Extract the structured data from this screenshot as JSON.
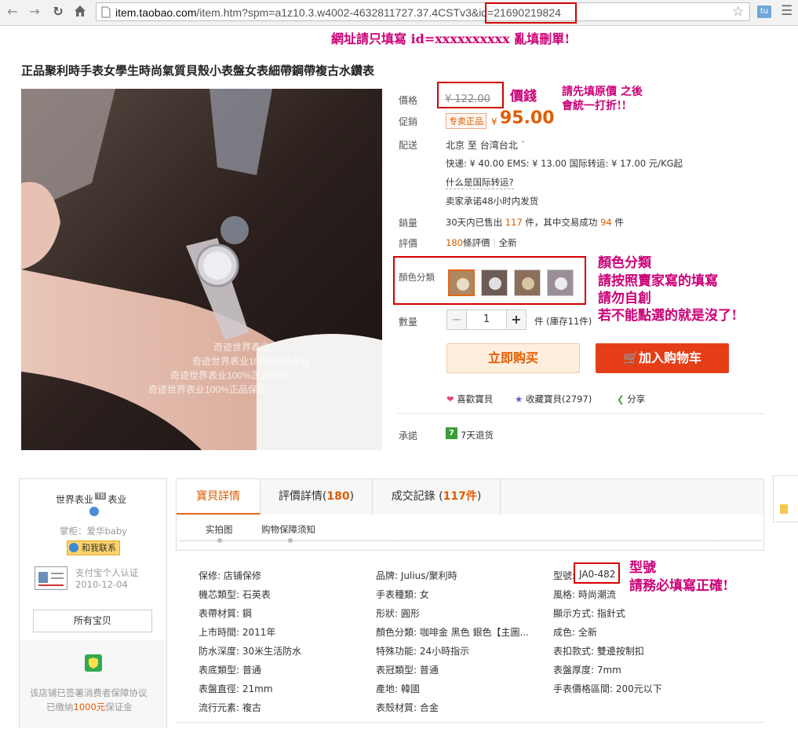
{
  "browser": {
    "url_main": "item.taobao.com",
    "url_rest": "/item.htm?spm=a1z10.3.w4002-4632811727.37.4CSTv3&",
    "url_id": "id=21690219824",
    "ext_label": "tu"
  },
  "annotations": {
    "url_note": "網址請只填寫 id=xxxxxxxxxx   亂填刪單!",
    "price_note": "價錢",
    "price_note2_line1": "請先填原價  之後",
    "price_note2_line2": "會統一打折!!",
    "color_note_line1": "顏色分類",
    "color_note_line2": "請按照賣家寫的填寫",
    "color_note_line3": "請勿自創",
    "color_note_line4": "若不能點選的就是沒了!",
    "model_note_line1": "型號",
    "model_note_line2": "請務必填寫正確!"
  },
  "product": {
    "title": "正品聚利時手表女學生時尚氣質貝殼小表盤女表細帶鋼帶複古水鑽表",
    "watermark_1": "奇迹世界表业",
    "watermark_2": "奇迹世界表业100%正品保证",
    "watermark_3": "奇迹世界表业100%正品保证",
    "watermark_4": "奇迹世界表业100%正品保证"
  },
  "pricing": {
    "price_label": "價格",
    "original_price": "¥ 122.00",
    "promo_label": "促銷",
    "promo_badge": "专卖正品",
    "promo_currency": "¥",
    "promo_price": "95.00"
  },
  "shipping": {
    "label": "配送",
    "from": "北京",
    "to_word": "至",
    "to": "台湾台北",
    "rates": "快递: ¥ 40.00    EMS: ¥ 13.00    国际转运: ¥ 17.00  元/KG起",
    "intl_question": "什么是国际转运?",
    "promise": "卖家承诺48小时内发货"
  },
  "sales": {
    "label": "銷量",
    "text_a": "30天内已售出",
    "sold": "117",
    "text_b": "件，其中交易成功",
    "success": "94",
    "text_c": "件"
  },
  "reviews": {
    "label": "評價",
    "count": "180",
    "text": "條評價",
    "sep": "|",
    "link": "全新"
  },
  "color": {
    "label": "顏色分類"
  },
  "quantity": {
    "label": "數量",
    "minus": "−",
    "value": "1",
    "plus": "+",
    "stock": "件 (庫存11件)"
  },
  "actions": {
    "buy_now": "立即购买",
    "add_cart": "加入购物车",
    "like": "喜歡寶貝",
    "collect": "收藏寶貝(2797)",
    "share": "分享"
  },
  "promise": {
    "label": "承諾",
    "badge": "7",
    "text": "7天退货"
  },
  "shop": {
    "name": "世界表业",
    "tag": "TB",
    "suffix": "表业",
    "keeper": "掌柜：爱华baby",
    "contact": "和我联系",
    "cert_text": "支付宝个人认证",
    "cert_date": "2010-12-04",
    "all_items": "所有宝贝",
    "guarantee_1": "该店铺已签署消费者保障协议",
    "guarantee_2a": "已缴纳",
    "guarantee_amount": "1000元",
    "guarantee_2b": "保证金"
  },
  "tabs": {
    "details": "寶貝詳情",
    "reviews_a": "評價詳情(",
    "reviews_n": "180",
    "reviews_b": ")",
    "records_a": "成交記錄 (",
    "records_n": "117件",
    "records_b": ")",
    "sub_1": "实拍图",
    "sub_2": "购物保障须知"
  },
  "specs": {
    "col1": [
      "保修: 店铺保修",
      "機芯類型: 石英表",
      "表帶材質: 鋼",
      "上市時間: 2011年",
      "防水深度: 30米生活防水",
      "表底類型: 普通",
      "表盤直徑: 21mm",
      "流行元素: 複古"
    ],
    "col2": [
      "品牌: Julius/聚利時",
      "手表種類: 女",
      "形狀: 圓形",
      "顏色分類: 咖啡金 黑色 銀色【主圖...",
      "特殊功能: 24小時指示",
      "表冠類型: 普通",
      "產地: 韓國",
      "表殼材質: 合金"
    ],
    "col3_model_label": "型號:",
    "col3_model": "JA0-482",
    "col3": [
      "風格: 時尚潮流",
      "顯示方式: 指針式",
      "成色: 全新",
      "表扣款式: 雙邊按制扣",
      "表盤厚度: 7mm",
      "手表價格區間: 200元以下"
    ]
  },
  "colors": {
    "accent_orange": "#e4661a",
    "price_orange": "#e35b00",
    "annotation_pink": "#cc0077",
    "highlight_red": "#d40000",
    "cart_red": "#e53e16"
  }
}
